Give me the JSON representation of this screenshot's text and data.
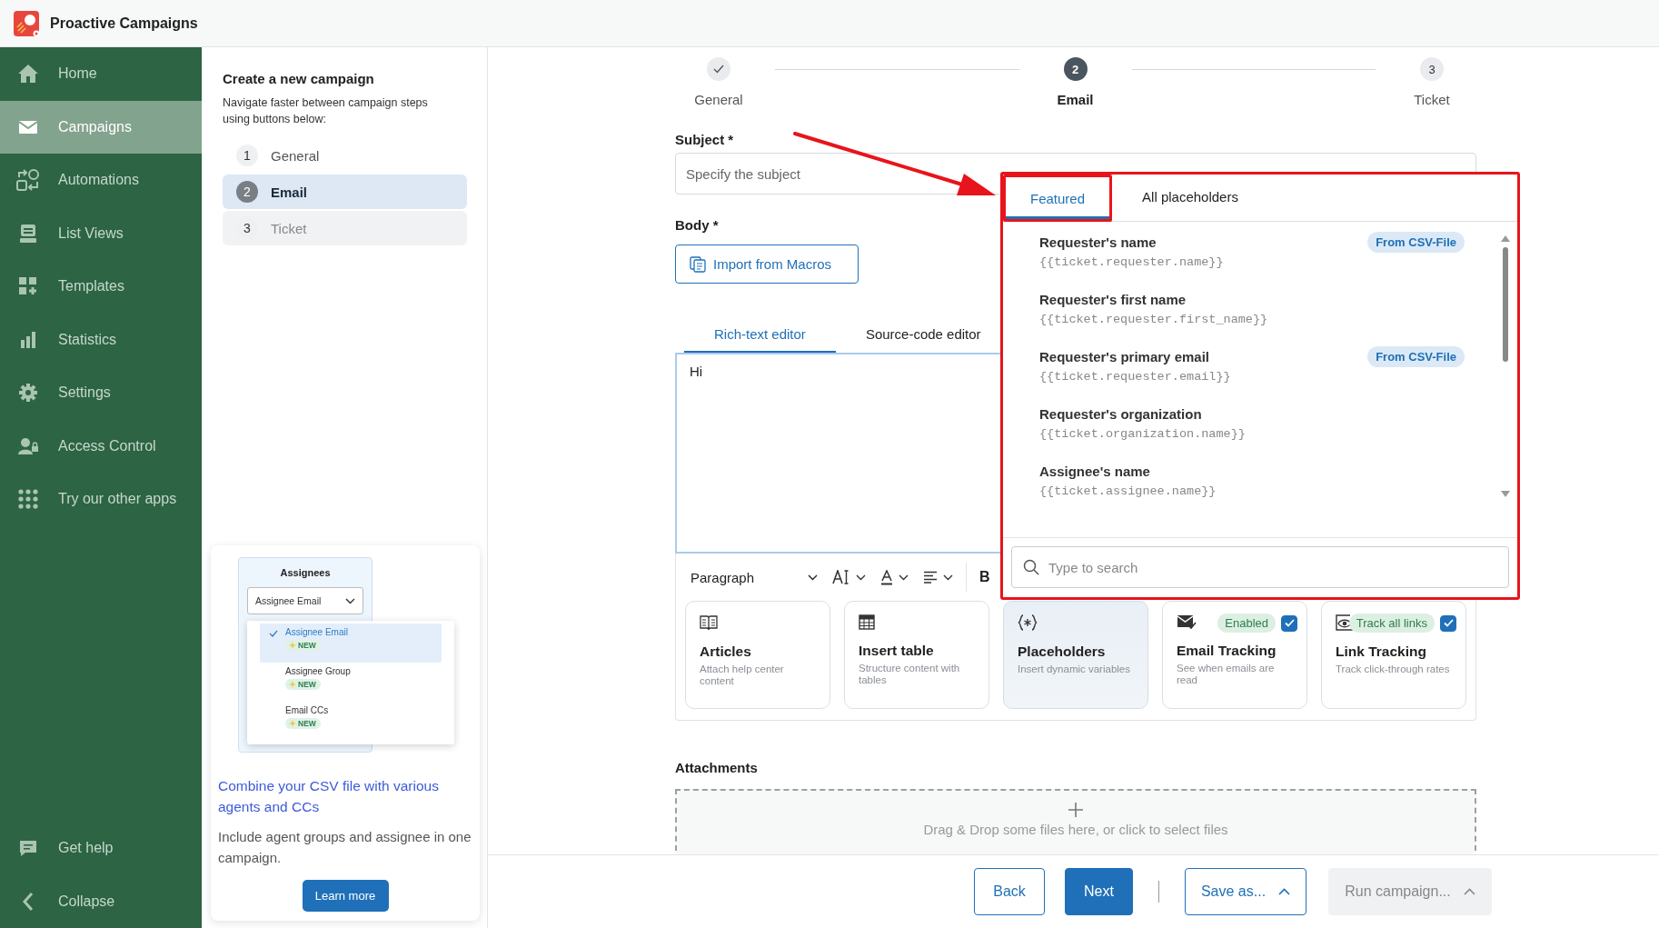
{
  "app": {
    "title": "Proactive Campaigns"
  },
  "sidebar": {
    "items": [
      {
        "label": "Home",
        "selected": false
      },
      {
        "label": "Campaigns",
        "selected": true
      },
      {
        "label": "Automations",
        "selected": false
      },
      {
        "label": "List Views",
        "selected": false
      },
      {
        "label": "Templates",
        "selected": false
      },
      {
        "label": "Statistics",
        "selected": false
      },
      {
        "label": "Settings",
        "selected": false
      },
      {
        "label": "Access Control",
        "selected": false
      },
      {
        "label": "Try our other apps",
        "selected": false
      }
    ],
    "footer_items": [
      {
        "label": "Get help"
      },
      {
        "label": "Collapse"
      }
    ]
  },
  "wizard_panel": {
    "title": "Create a new campaign",
    "description": "Navigate faster between campaign steps using buttons below:",
    "steps": [
      {
        "number": "1",
        "label": "General",
        "selected": false,
        "disabled": false
      },
      {
        "number": "2",
        "label": "Email",
        "selected": true,
        "disabled": false
      },
      {
        "number": "3",
        "label": "Ticket",
        "selected": false,
        "disabled": true
      }
    ]
  },
  "promo": {
    "preview": {
      "title": "Assignees",
      "select_value": "Assignee Email",
      "options": [
        {
          "label": "Assignee Email",
          "badge": "NEW",
          "selected": true
        },
        {
          "label": "Assignee Group",
          "badge": "NEW",
          "selected": false
        },
        {
          "label": "Email CCs",
          "badge": "NEW",
          "selected": false
        }
      ]
    },
    "heading": "Combine your CSV file with various agents and CCs",
    "text": "Include agent groups and assignee in one campaign.",
    "button": "Learn more"
  },
  "stepper": [
    {
      "label": "General",
      "completed": true,
      "selected": false
    },
    {
      "number": "2",
      "label": "Email",
      "completed": false,
      "selected": true
    },
    {
      "number": "3",
      "label": "Ticket",
      "completed": false,
      "selected": false
    }
  ],
  "subject": {
    "label": "Subject *",
    "placeholder": "Specify the subject"
  },
  "body": {
    "label": "Body *",
    "import_button": "Import from Macros",
    "editor_tabs": [
      {
        "label": "Rich-text editor",
        "selected": true
      },
      {
        "label": "Source-code editor",
        "selected": false
      }
    ],
    "value": "Hi",
    "toolbar": {
      "block_format": "Paragraph",
      "bold": "B"
    },
    "cards": [
      {
        "kind": "articles",
        "title": "Articles",
        "description": "Attach help center content",
        "selected": false
      },
      {
        "kind": "table",
        "title": "Insert table",
        "description": "Structure content with tables",
        "selected": false
      },
      {
        "kind": "placeholders",
        "title": "Placeholders",
        "description": "Insert dynamic variables",
        "selected": true
      },
      {
        "kind": "email_tracking",
        "title": "Email Tracking",
        "description": "See when emails are read",
        "selected": false,
        "badge": "Enabled",
        "checked": true
      },
      {
        "kind": "link_tracking",
        "title": "Link Tracking",
        "description": "Track click-through rates",
        "selected": false,
        "badge": "Track all links",
        "checked": true
      }
    ]
  },
  "placeholder_popup": {
    "tabs": [
      {
        "label": "Featured",
        "selected": true,
        "highlighted": true
      },
      {
        "label": "All placeholders",
        "selected": false,
        "highlighted": false
      }
    ],
    "items": [
      {
        "name": "Requester's name",
        "code": "{{ticket.requester.name}}",
        "badge": "From CSV-File"
      },
      {
        "name": "Requester's first name",
        "code": "{{ticket.requester.first_name}}"
      },
      {
        "name": "Requester's primary email",
        "code": "{{ticket.requester.email}}",
        "badge": "From CSV-File"
      },
      {
        "name": "Requester's organization",
        "code": "{{ticket.organization.name}}"
      },
      {
        "name": "Assignee's name",
        "code": "{{ticket.assignee.name}}"
      }
    ],
    "search": {
      "placeholder": "Type to search"
    }
  },
  "attachments": {
    "label": "Attachments",
    "dropzone_text": "Drag & Drop some files here, or click to select files"
  },
  "footer": {
    "navigation_buttons": [
      {
        "label": "Back",
        "kind": "secondary"
      },
      {
        "label": "Next",
        "kind": "primary"
      }
    ],
    "action_buttons": [
      {
        "label": "Save as...",
        "disabled": false
      },
      {
        "label": "Run campaign...",
        "disabled": true
      }
    ]
  }
}
